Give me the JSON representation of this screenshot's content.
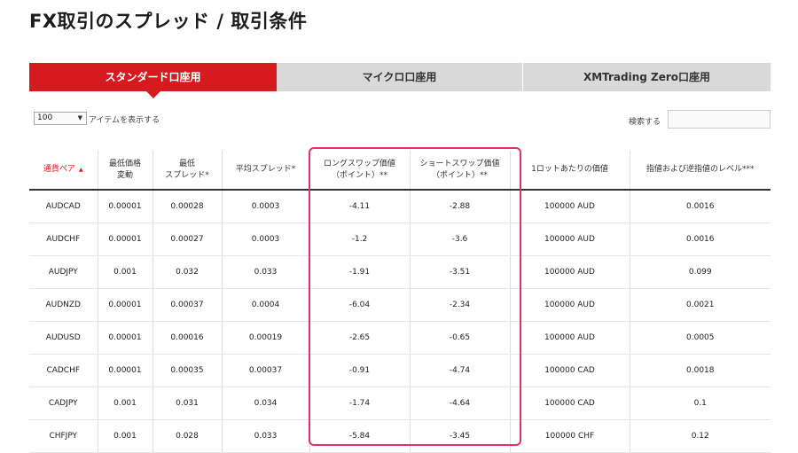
{
  "page_title": "FX取引のスプレッド / 取引条件",
  "tabs": [
    {
      "label": "スタンダード口座用",
      "active": true
    },
    {
      "label": "マイクロ口座用",
      "active": false
    },
    {
      "label": "XMTrading Zero口座用",
      "active": false
    }
  ],
  "controls": {
    "per_page_value": "100",
    "per_page_label": "アイテムを表示する",
    "search_label": "検索する",
    "search_value": ""
  },
  "table": {
    "headers": [
      "通貨ペア",
      "最低価格\n変動",
      "最低\nスプレッド*",
      "平均スプレッド*",
      "ロングスワップ価値\n（ポイント）**",
      "ショートスワップ価値\n（ポイント）**",
      "1ロットあたりの価値",
      "指値および逆指値のレベル***"
    ],
    "rows": [
      [
        "AUDCAD",
        "0.00001",
        "0.00028",
        "0.0003",
        "-4.11",
        "-2.88",
        "100000 AUD",
        "0.0016"
      ],
      [
        "AUDCHF",
        "0.00001",
        "0.00027",
        "0.0003",
        "-1.2",
        "-3.6",
        "100000 AUD",
        "0.0016"
      ],
      [
        "AUDJPY",
        "0.001",
        "0.032",
        "0.033",
        "-1.91",
        "-3.51",
        "100000 AUD",
        "0.099"
      ],
      [
        "AUDNZD",
        "0.00001",
        "0.00037",
        "0.0004",
        "-6.04",
        "-2.34",
        "100000 AUD",
        "0.0021"
      ],
      [
        "AUDUSD",
        "0.00001",
        "0.00016",
        "0.00019",
        "-2.65",
        "-0.65",
        "100000 AUD",
        "0.0005"
      ],
      [
        "CADCHF",
        "0.00001",
        "0.00035",
        "0.00037",
        "-0.91",
        "-4.74",
        "100000 CAD",
        "0.0018"
      ],
      [
        "CADJPY",
        "0.001",
        "0.031",
        "0.034",
        "-1.74",
        "-4.64",
        "100000 CAD",
        "0.1"
      ],
      [
        "CHFJPY",
        "0.001",
        "0.028",
        "0.033",
        "-5.84",
        "-3.45",
        "100000 CHF",
        "0.12"
      ]
    ]
  },
  "colors": {
    "brand_red": "#d71920",
    "highlight_pink": "#e0306a",
    "tab_inactive": "#d9d9d9"
  },
  "icons": {
    "dropdown": "chevron-down-icon",
    "sort": "sort-ascending-icon"
  }
}
